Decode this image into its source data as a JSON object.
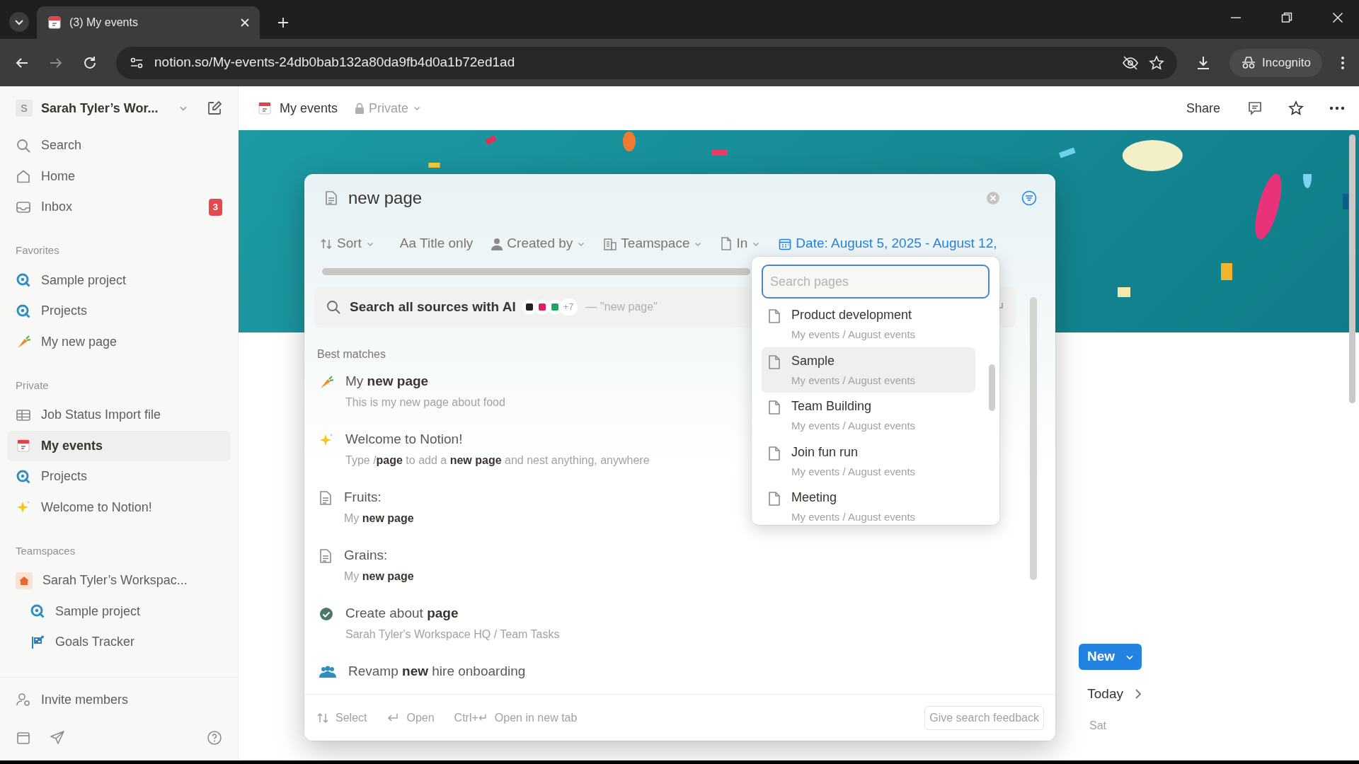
{
  "browser": {
    "tab_title": "(3) My events",
    "url": "notion.so/My-events-24db0bab132a80da9fb4d0a1b72ed1ad",
    "profile": "Incognito"
  },
  "sidebar": {
    "workspace": "Sarah Tyler’s Wor...",
    "workspace_initial": "S",
    "nav": [
      {
        "label": "Search"
      },
      {
        "label": "Home"
      },
      {
        "label": "Inbox",
        "badge": "3"
      }
    ],
    "sections": [
      {
        "title": "Favorites",
        "items": [
          {
            "label": "Sample project",
            "selected": false
          },
          {
            "label": "Projects",
            "selected": false
          },
          {
            "label": "My new page",
            "selected": false
          }
        ]
      },
      {
        "title": "Private",
        "items": [
          {
            "label": "Job Status Import file",
            "selected": false
          },
          {
            "label": "My events",
            "selected": true
          },
          {
            "label": "Projects",
            "selected": false
          },
          {
            "label": "Welcome to Notion!",
            "selected": false
          }
        ]
      },
      {
        "title": "Teamspaces",
        "items": [
          {
            "label": "Sarah Tyler’s Workspac...",
            "selected": false,
            "children": [
              {
                "label": "Sample project",
                "selected": false
              },
              {
                "label": "Goals Tracker",
                "selected": false
              }
            ]
          }
        ]
      }
    ],
    "invite": "Invite members"
  },
  "page": {
    "title": "My events",
    "visibility": "Private",
    "share": "Share",
    "new_button": "New",
    "today": "Today",
    "weekday": "Sat"
  },
  "search": {
    "query": "new page",
    "filters": [
      {
        "label": "Sort",
        "active": false,
        "caret": true
      },
      {
        "prefix": "Aa",
        "label": "Title only",
        "active": false,
        "caret": false
      },
      {
        "label": "Created by",
        "active": false,
        "caret": true
      },
      {
        "label": "Teamspace",
        "active": false,
        "caret": true
      },
      {
        "label": "In",
        "active": false,
        "caret": true
      },
      {
        "label": "Date: August 5, 2025 - August 12,",
        "active": true,
        "caret": false
      }
    ],
    "ai": {
      "label": "Search all sources with AI",
      "more": "+7",
      "hint": "— \"new page\""
    },
    "section": "Best matches",
    "results": [
      {
        "title": "My **new page**",
        "subtitle": "This is my new page about food"
      },
      {
        "title": "Welcome to Notion!",
        "subtitle": "Type /**page** to add a **new page** and nest anything, anywhere"
      },
      {
        "title": "Fruits:",
        "subtitle": "My **new page**"
      },
      {
        "title": "Grains:",
        "subtitle": "My **new page**"
      },
      {
        "title": "Create about **page**",
        "subtitle": "Sarah Tyler's Workspace HQ / Team Tasks"
      },
      {
        "title": "Revamp **new** hire onboarding"
      }
    ],
    "hints": [
      {
        "label": "Select"
      },
      {
        "label": "Open"
      },
      {
        "shortcut": "Ctrl+↵",
        "label": "Open in new tab"
      }
    ],
    "feedback": "Give search feedback",
    "in_menu": {
      "placeholder": "Search pages",
      "items": [
        {
          "title": "Product development",
          "path": "My events / August events",
          "hovered": false
        },
        {
          "title": "Sample",
          "path": "My events / August events",
          "hovered": true
        },
        {
          "title": "Team Building",
          "path": "My events / August events",
          "hovered": false
        },
        {
          "title": "Join fun run",
          "path": "My events / August events",
          "hovered": false
        },
        {
          "title": "Meeting",
          "path": "My events / August events",
          "hovered": false
        }
      ]
    }
  }
}
